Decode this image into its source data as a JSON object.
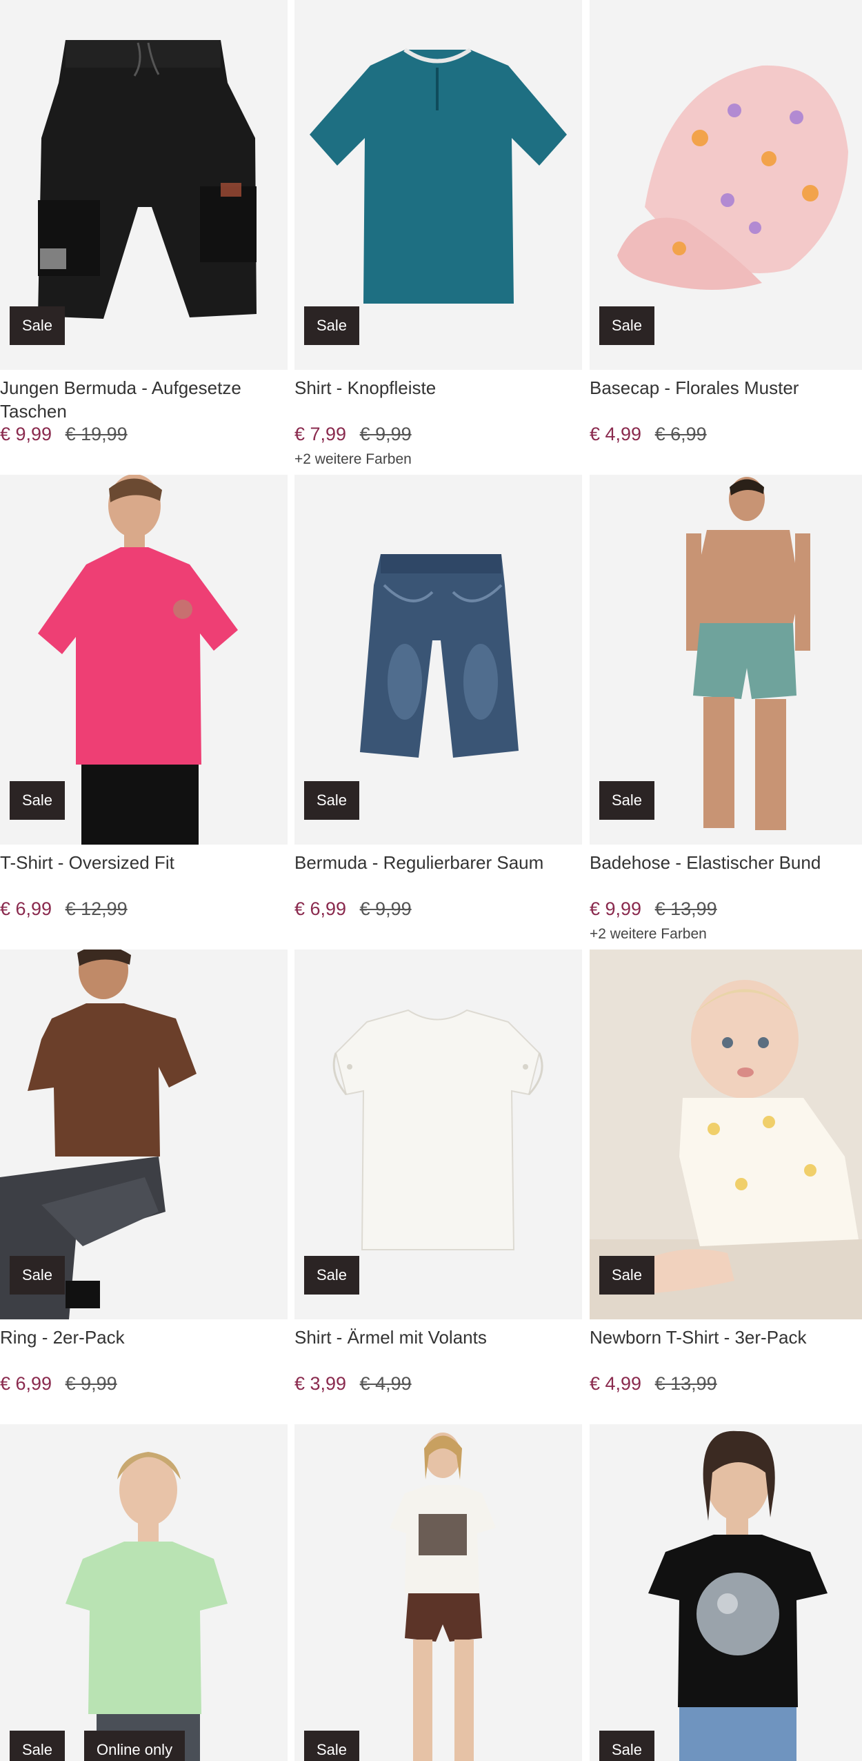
{
  "badges": {
    "sale": "Sale",
    "online_only": "Online only"
  },
  "products": [
    {
      "title": "Jungen Bermuda - Aufgesetze Taschen",
      "price": "€ 9,99",
      "old_price": "€ 19,99",
      "more_colors": "",
      "image": "black-cargo-shorts"
    },
    {
      "title": "Shirt - Knopfleiste",
      "price": "€ 7,99",
      "old_price": "€ 9,99",
      "more_colors": "+2 weitere Farben",
      "image": "teal-henley-shirt"
    },
    {
      "title": "Basecap - Florales Muster",
      "price": "€ 4,99",
      "old_price": "€ 6,99",
      "more_colors": "",
      "image": "pink-floral-cap"
    },
    {
      "title": "T-Shirt - Oversized Fit",
      "price": "€ 6,99",
      "old_price": "€ 12,99",
      "more_colors": "",
      "image": "man-pink-tshirt"
    },
    {
      "title": "Bermuda - Regulierbarer Saum",
      "price": "€ 6,99",
      "old_price": "€ 9,99",
      "more_colors": "",
      "image": "denim-bermuda"
    },
    {
      "title": "Badehose - Elastischer Bund",
      "price": "€ 9,99",
      "old_price": "€ 13,99",
      "more_colors": "+2 weitere Farben",
      "image": "man-swim-shorts"
    },
    {
      "title": "Ring - 2er-Pack",
      "price": "€ 6,99",
      "old_price": "€ 9,99",
      "more_colors": "",
      "image": "man-brown-tshirt"
    },
    {
      "title": "Shirt - Ärmel mit Volants",
      "price": "€ 3,99",
      "old_price": "€ 4,99",
      "more_colors": "",
      "image": "white-ruffle-shirt"
    },
    {
      "title": "Newborn T-Shirt - 3er-Pack",
      "price": "€ 4,99",
      "old_price": "€ 13,99",
      "more_colors": "",
      "image": "baby-tshirt"
    },
    {
      "title": "",
      "price": "",
      "old_price": "",
      "more_colors": "",
      "image": "woman-green-top"
    },
    {
      "title": "",
      "price": "",
      "old_price": "",
      "more_colors": "",
      "image": "woman-print-tshirt-shorts"
    },
    {
      "title": "",
      "price": "",
      "old_price": "",
      "more_colors": "",
      "image": "woman-black-moon-tshirt"
    }
  ],
  "colors": {
    "price": "#8a2a4e",
    "badge_bg": "#2b2424",
    "text": "#333333"
  }
}
